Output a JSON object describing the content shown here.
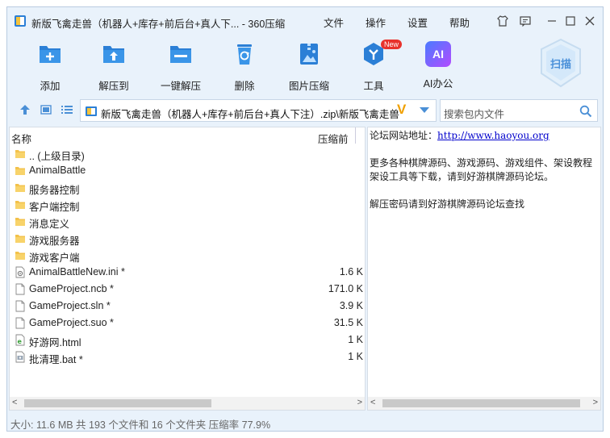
{
  "window": {
    "title": "新版飞禽走兽（机器人+库存+前后台+真人下... - 360压缩",
    "menu": [
      "文件",
      "操作",
      "设置",
      "帮助"
    ]
  },
  "toolbar": {
    "items": [
      {
        "label": "添加",
        "icon": "add-icon"
      },
      {
        "label": "解压到",
        "icon": "extract-to-icon"
      },
      {
        "label": "一键解压",
        "icon": "one-click-extract-icon"
      },
      {
        "label": "删除",
        "icon": "delete-icon"
      },
      {
        "label": "图片压缩",
        "icon": "image-compress-icon"
      },
      {
        "label": "工具",
        "icon": "tools-icon",
        "badge": "New"
      },
      {
        "label": "AI办公",
        "icon": "ai-office-icon",
        "glyph": "AI"
      }
    ],
    "scan_label": "扫描"
  },
  "address": {
    "path": "新版飞禽走兽（机器人+库存+前后台+真人下注）.zip\\新版飞禽走兽",
    "vip_mark": "V"
  },
  "search": {
    "placeholder": "搜索包内文件"
  },
  "filelist": {
    "header_name": "名称",
    "header_size": "压缩前",
    "rows": [
      {
        "name": ".. (上级目录)",
        "size": "",
        "type": "folder"
      },
      {
        "name": "AnimalBattle",
        "size": "",
        "type": "folder"
      },
      {
        "name": "服务器控制",
        "size": "",
        "type": "folder"
      },
      {
        "name": "客户端控制",
        "size": "",
        "type": "folder"
      },
      {
        "name": "消息定义",
        "size": "",
        "type": "folder"
      },
      {
        "name": "游戏服务器",
        "size": "",
        "type": "folder"
      },
      {
        "name": "游戏客户端",
        "size": "",
        "type": "folder"
      },
      {
        "name": "AnimalBattleNew.ini *",
        "size": "1.6 K",
        "type": "ini"
      },
      {
        "name": "GameProject.ncb *",
        "size": "171.0 K",
        "type": "file"
      },
      {
        "name": "GameProject.sln *",
        "size": "3.9 K",
        "type": "file"
      },
      {
        "name": "GameProject.suo *",
        "size": "31.5 K",
        "type": "file"
      },
      {
        "name": "好游网.html",
        "size": "1 K",
        "type": "html"
      },
      {
        "name": "批清理.bat *",
        "size": "1 K",
        "type": "bat"
      }
    ]
  },
  "comment": {
    "site_label": "论坛网站地址：",
    "site_url": "http://www.haoyou.org",
    "line2": "更多各种棋牌源码、游戏源码、游戏组件、架设教程",
    "line3": "架设工具等下载，请到好游棋牌源码论坛。",
    "line4": "解压密码请到好游棋牌源码论坛查找"
  },
  "status": {
    "text": "大小: 11.6 MB 共 193 个文件和 16 个文件夹 压缩率 77.9%"
  },
  "colors": {
    "accent": "#2b7fd6",
    "window_bg": "#e9f2fb",
    "badge": "#e8322c"
  }
}
